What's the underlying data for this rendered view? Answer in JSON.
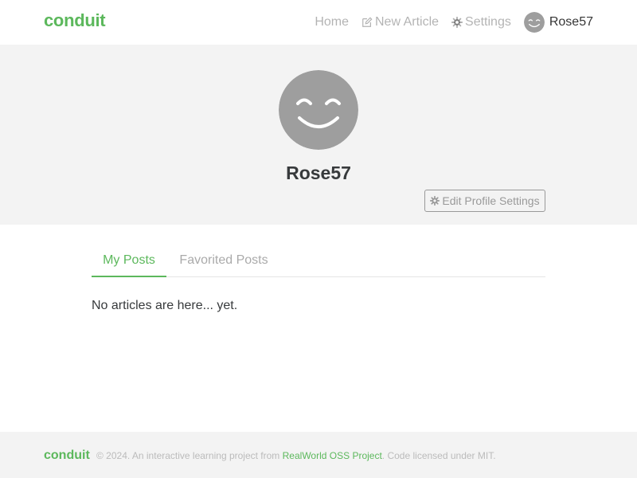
{
  "brand": "conduit",
  "colors": {
    "accent": "#5cb85c",
    "banner_bg": "#f3f3f3",
    "avatar_gray": "#9e9e9e"
  },
  "nav": {
    "home": "Home",
    "new_article": "New Article",
    "settings": "Settings",
    "username": "Rose57",
    "icons": {
      "new_article": "edit-icon",
      "settings": "gear-icon",
      "avatar": "smiley-avatar"
    }
  },
  "profile": {
    "username": "Rose57",
    "edit_button": "Edit Profile Settings",
    "edit_icon": "gear-icon"
  },
  "tabs": [
    {
      "label": "My Posts",
      "active": true
    },
    {
      "label": "Favorited Posts",
      "active": false
    }
  ],
  "articles": {
    "empty_message": "No articles are here... yet."
  },
  "footer": {
    "logo": "conduit",
    "text_before": "© 2024. An interactive learning project from",
    "link": "RealWorld OSS Project",
    "text_after": ". Code licensed under MIT."
  }
}
